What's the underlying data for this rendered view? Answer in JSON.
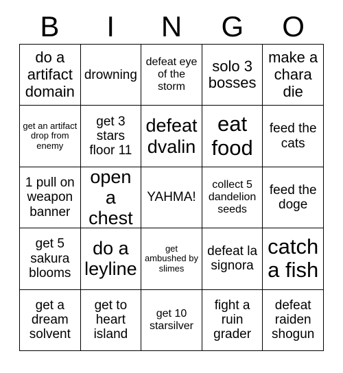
{
  "card": {
    "title": "BINGO",
    "header_letters": [
      "B",
      "I",
      "N",
      "G",
      "O"
    ],
    "colors": {
      "background": "#ffffff",
      "grid_line": "#000000",
      "text": "#000000"
    },
    "grid_size": "5x5",
    "rows": [
      [
        {
          "text": "do a artifact domain",
          "size": "lg"
        },
        {
          "text": "drowning",
          "size": "md"
        },
        {
          "text": "defeat eye of the storm",
          "size": "sm"
        },
        {
          "text": "solo 3 bosses",
          "size": "lg"
        },
        {
          "text": "make a chara die",
          "size": "lg"
        }
      ],
      [
        {
          "text": "get an artifact drop from enemy",
          "size": "xs"
        },
        {
          "text": "get 3 stars floor 11",
          "size": "md"
        },
        {
          "text": "defeat dvalin",
          "size": "xl"
        },
        {
          "text": "eat food",
          "size": "xxl"
        },
        {
          "text": "feed the cats",
          "size": "md"
        }
      ],
      [
        {
          "text": "1 pull on weapon banner",
          "size": "md"
        },
        {
          "text": "open a chest",
          "size": "xl"
        },
        {
          "text": "YAHMA!",
          "size": "md"
        },
        {
          "text": "collect 5 dandelion seeds",
          "size": "sm"
        },
        {
          "text": "feed the doge",
          "size": "md"
        }
      ],
      [
        {
          "text": "get 5 sakura blooms",
          "size": "md"
        },
        {
          "text": "do a leyline",
          "size": "xl"
        },
        {
          "text": "get ambushed by slimes",
          "size": "xs"
        },
        {
          "text": "defeat la signora",
          "size": "md"
        },
        {
          "text": "catch a fish",
          "size": "xxl"
        }
      ],
      [
        {
          "text": "get a dream solvent",
          "size": "md"
        },
        {
          "text": "get to heart island",
          "size": "md"
        },
        {
          "text": "get 10 starsilver",
          "size": "sm"
        },
        {
          "text": "fight a ruin grader",
          "size": "md"
        },
        {
          "text": "defeat raiden shogun",
          "size": "md"
        }
      ]
    ]
  }
}
